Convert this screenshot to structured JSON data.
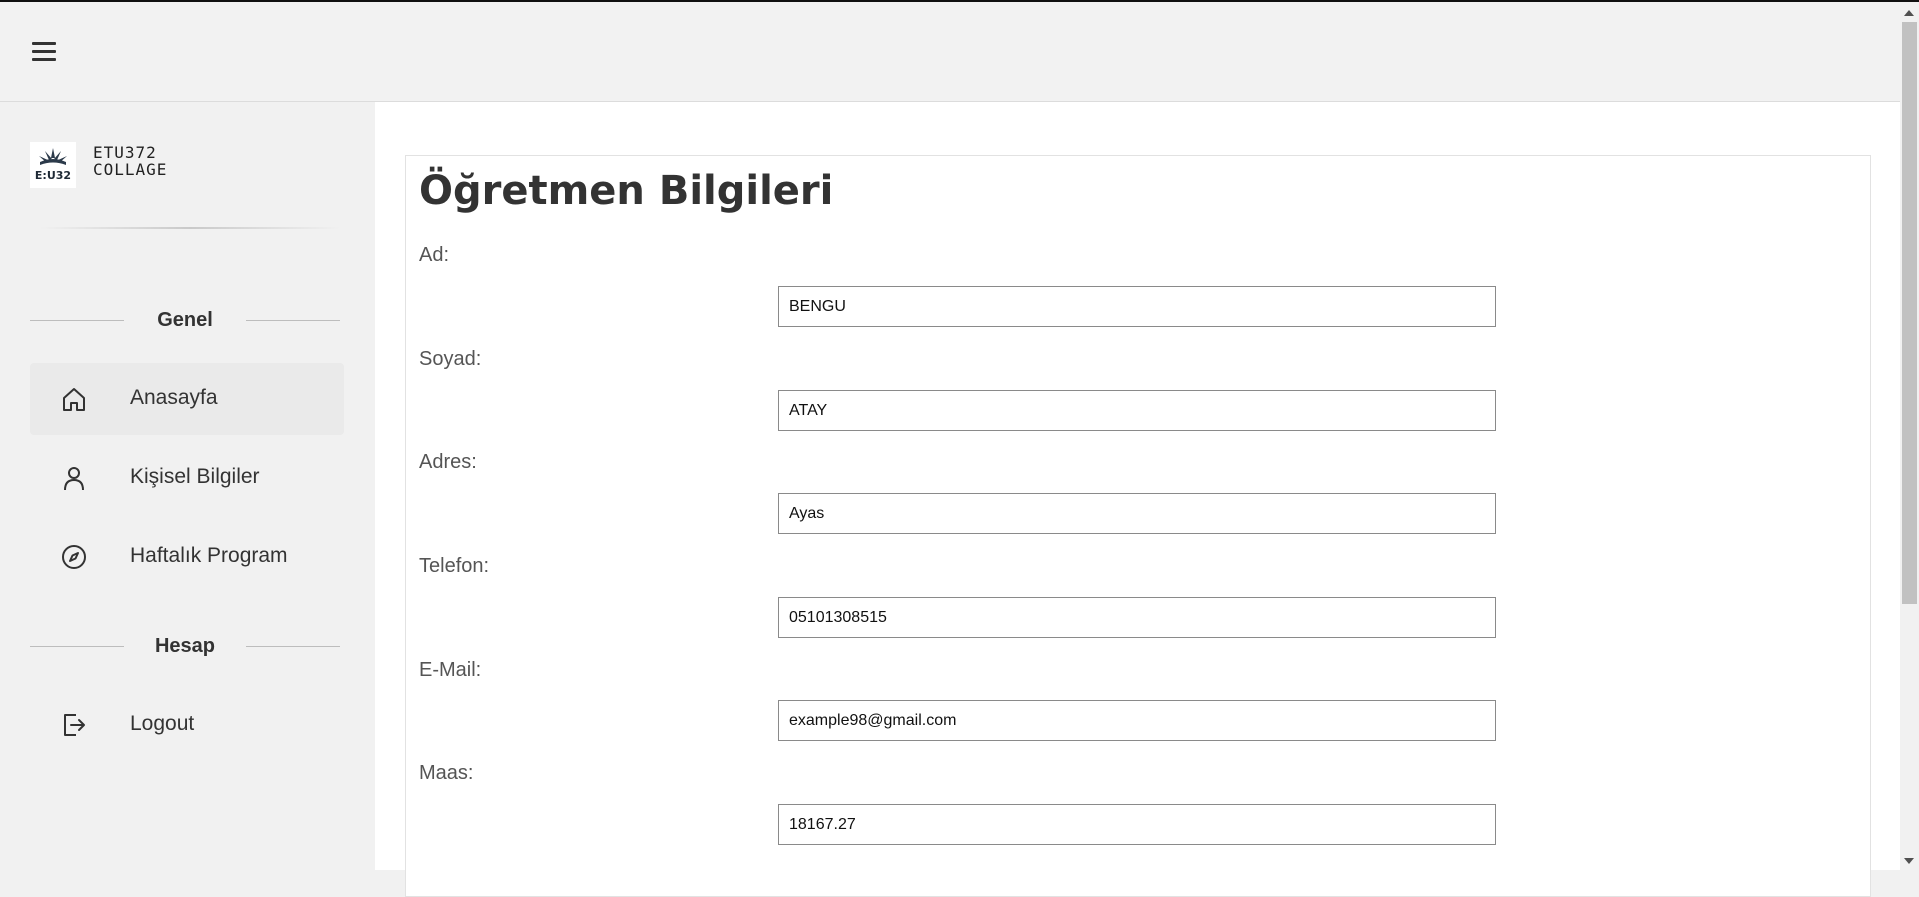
{
  "header": {
    "menu_icon": "hamburger-menu-icon"
  },
  "brand": {
    "line1": "ETU372",
    "line2": "COLLAGE",
    "logo_text": "E:U32"
  },
  "sidebar": {
    "sections": [
      {
        "title": "Genel"
      },
      {
        "title": "Hesap"
      }
    ],
    "items": [
      {
        "label": "Anasayfa",
        "icon": "home-icon",
        "active": true
      },
      {
        "label": "Kişisel Bilgiler",
        "icon": "user-icon",
        "active": false
      },
      {
        "label": "Haftalık Program",
        "icon": "compass-icon",
        "active": false
      },
      {
        "label": "Logout",
        "icon": "logout-icon",
        "active": false
      }
    ]
  },
  "page": {
    "title": "Öğretmen Bilgileri",
    "fields": [
      {
        "label": "Ad:",
        "value": "BENGU"
      },
      {
        "label": "Soyad:",
        "value": "ATAY"
      },
      {
        "label": "Adres:",
        "value": "Ayas"
      },
      {
        "label": "Telefon:",
        "value": "05101308515"
      },
      {
        "label": "E-Mail:",
        "value": "example98@gmail.com"
      },
      {
        "label": "Maas:",
        "value": "18167.27"
      }
    ]
  },
  "colors": {
    "sidebar_bg": "#f1f1f1",
    "content_bg": "#ffffff",
    "active_item_bg": "#eaeaea"
  }
}
